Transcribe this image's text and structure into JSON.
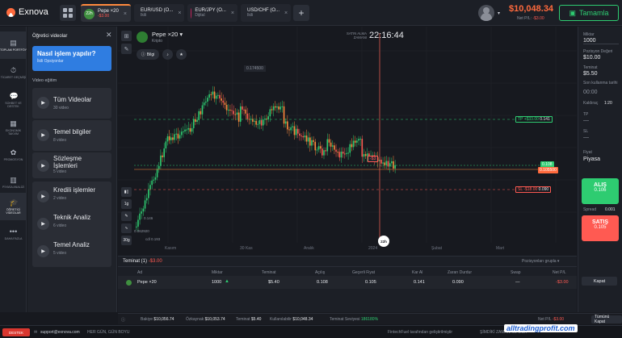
{
  "app": {
    "name": "Exnova"
  },
  "tabs": [
    {
      "name": "Pepe ×20",
      "sub": "-$3.00",
      "sub_neg": true,
      "avatar": "22h",
      "color": "#3f8f3f",
      "active": true
    },
    {
      "name": "EUR/USD (O...",
      "sub": "Ikili",
      "sub_neg": false,
      "avatar": "",
      "color": "#3b5bdb",
      "active": false
    },
    {
      "name": "EUR/JPY (O...",
      "sub": "Dijital",
      "sub_neg": false,
      "avatar": "",
      "color": "#c2255c",
      "active": false
    },
    {
      "name": "USD/CHF (O...",
      "sub": "Ikili",
      "sub_neg": false,
      "avatar": "",
      "color": "#e03131",
      "active": false
    }
  ],
  "header": {
    "balance": "$10,048.34",
    "netpl_label": "Net P/L",
    "netpl_value": "-$3.00",
    "deposit": "Tamamla"
  },
  "nav": [
    {
      "icon": "▤",
      "label": "TOPLAM PORTFÖY",
      "active": true
    },
    {
      "icon": "⏱",
      "label": "TİCARET GEÇMİŞİ",
      "active": false
    },
    {
      "icon": "💬",
      "label": "SOHBET VE DESTEK",
      "active": false
    },
    {
      "icon": "▦",
      "label": "EKONOMİK TAKVİM",
      "active": false
    },
    {
      "icon": "✿",
      "label": "PROMOSYON",
      "active": false
    },
    {
      "icon": "▥",
      "label": "PİYASA ANALİZİ",
      "active": false
    },
    {
      "icon": "🎓",
      "label": "ÖĞRETİCİ VİDEOLAR",
      "active": false
    },
    {
      "icon": "•••",
      "label": "DAHA FAZLA",
      "active": false
    }
  ],
  "panel": {
    "title": "Öğretici videolar",
    "promo_title": "Nasıl işlem yapılır?",
    "promo_sub": "İkili Opsiyonlar",
    "section": "Video eğitim",
    "cards": [
      {
        "title": "Tüm Videolar",
        "sub": "30 video"
      },
      {
        "title": "Temel bilgiler",
        "sub": "8 video"
      },
      {
        "title": "Sözleşme İşlemleri",
        "sub": "5 video"
      },
      {
        "title": "Kredili işlemler",
        "sub": "2 video"
      },
      {
        "title": "Teknik Analiz",
        "sub": "6 video"
      },
      {
        "title": "Temel Analiz",
        "sub": "5 video"
      }
    ]
  },
  "chart": {
    "asset": "Pepe ×20",
    "category": "Kripto",
    "info_btn": "Bilgi",
    "timer_label": "SATIN ALMA ZAMANI",
    "timer": "22:16:44",
    "expiry_badge": "22h",
    "peak_label": "0.174500",
    "low_label": "0.062920",
    "low_label2": "cdl 0.193",
    "left_annot": "0.146",
    "tp_label": "TP +$33.00",
    "tp_price": "0.141",
    "sl_label": "SL -$18.00",
    "sl_price": "0.090",
    "current_price": "0.108",
    "entry_price": "0.105500",
    "marker": "-$3",
    "timeframes": [
      "1g",
      "30g"
    ],
    "x_labels": [
      "Kasım",
      "30 Kas",
      "Aralık",
      "2024",
      "Şubat",
      "Mart"
    ]
  },
  "trade": {
    "amount_label": "Miktar",
    "amount": "1000",
    "pos_value_label": "Pozisyon Değeri",
    "pos_value": "$10.00",
    "margin_label": "Teminat",
    "margin": "$5.50",
    "expiry_label": "Son kullanma tarihi",
    "expiry": "00:00",
    "leverage_label": "Kaldıraç",
    "leverage": "1:20",
    "tp_label": "TP",
    "tp_value": "—",
    "sl_label": "SL",
    "sl_value": "—",
    "price_label": "Fiyat",
    "price_mode": "Piyasa",
    "buy_label": "ALIŞ",
    "buy_price": "0.106",
    "spread_label": "Spread",
    "spread": "0.001",
    "sell_label": "SATIŞ",
    "sell_price": "0.105"
  },
  "positions": {
    "tab_label": "Teminat (1)",
    "tab_pl": "-$3.00",
    "group_label": "Pozisyonları grupla",
    "headers": [
      "Ad",
      "Miktar",
      "Teminat",
      "Açılış",
      "Geçerli Fiyat",
      "Kar Al",
      "Zararı Durdur",
      "Swap",
      "Net P/L"
    ],
    "row": {
      "name": "Pepe ×20",
      "amount": "1000",
      "margin": "$5.40",
      "open": "0.108",
      "current": "0.105",
      "tp": "0.141",
      "sl": "0.090",
      "swap": "—",
      "pl": "-$3.00",
      "close": "Kapat"
    }
  },
  "footer": {
    "balance_label": "Bakiye",
    "balance": "$10,056.74",
    "equity_label": "Özkaynak",
    "equity": "$10,053.74",
    "margin_label": "Teminat",
    "margin": "$5.40",
    "used_label": "Kullanılabilir",
    "used": "$10,048.34",
    "level_label": "Teminat Seviyesi",
    "level": "186180%",
    "netpl_label": "Net P/L",
    "netpl": "-$3.00",
    "close_all": "Tümünü Kapat"
  },
  "status": {
    "support": "DESTEK",
    "email": "support@exnova.com",
    "hours": "HER GÜN, GÜN BOYU",
    "powered": "FintechFuel tarafından geliştirilmiştir",
    "clock": "ŞİMDİKİ ZAMAN: 29 OCA"
  },
  "watermark": "alltradingprofit.com",
  "colors": {
    "up": "#2ecc71",
    "down": "#ff5a52",
    "accent": "#ff6a3d"
  }
}
